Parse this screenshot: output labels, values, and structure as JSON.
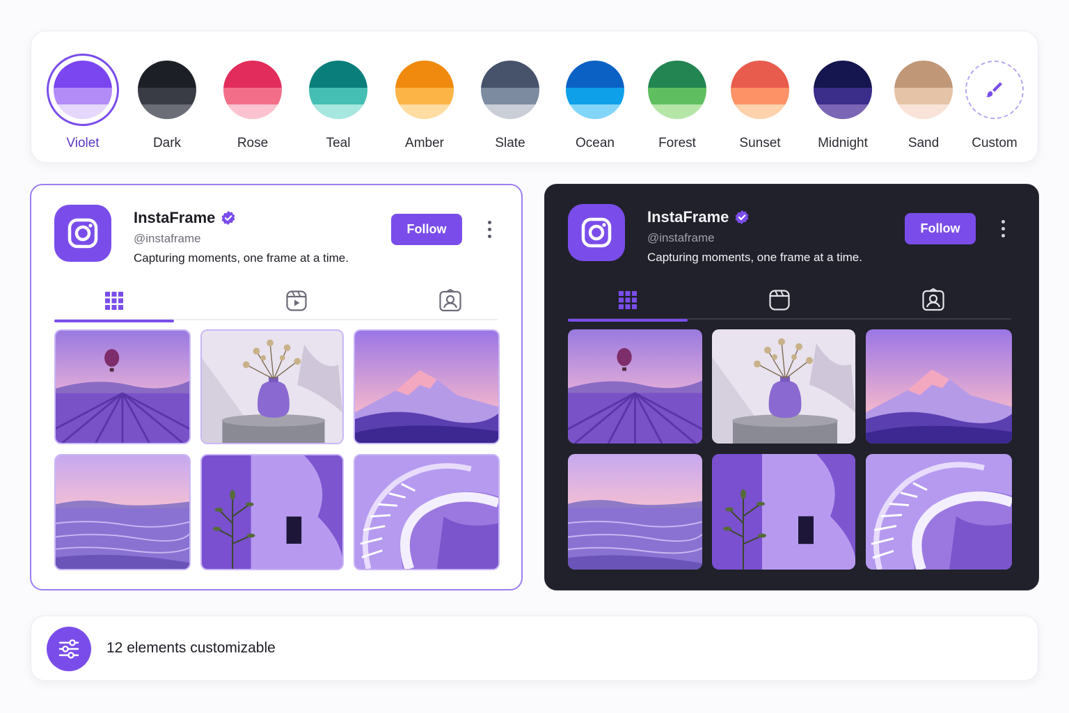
{
  "themes": [
    {
      "label": "Violet",
      "colors": [
        "#7b45f0",
        "#b48cf8",
        "#e6d8fd"
      ],
      "selected": true
    },
    {
      "label": "Dark",
      "colors": [
        "#1d1f26",
        "#3a3c45",
        "#6b6d77"
      ]
    },
    {
      "label": "Rose",
      "colors": [
        "#e12c5c",
        "#f36f89",
        "#fbc3cf"
      ]
    },
    {
      "label": "Teal",
      "colors": [
        "#0a7e7a",
        "#45bfb3",
        "#a6e7df"
      ]
    },
    {
      "label": "Amber",
      "colors": [
        "#ef8a0f",
        "#fdb446",
        "#fedca2"
      ]
    },
    {
      "label": "Slate",
      "colors": [
        "#46536a",
        "#7d8ba1",
        "#c9ced7"
      ]
    },
    {
      "label": "Ocean",
      "colors": [
        "#0b62c4",
        "#0fa0ea",
        "#83d5f8"
      ]
    },
    {
      "label": "Forest",
      "colors": [
        "#228552",
        "#5fbf60",
        "#b5e6a8"
      ]
    },
    {
      "label": "Sunset",
      "colors": [
        "#e85c4e",
        "#fd9266",
        "#fed2ad"
      ]
    },
    {
      "label": "Midnight",
      "colors": [
        "#15154f",
        "#3b2d8a",
        "#7a66b5"
      ]
    },
    {
      "label": "Sand",
      "colors": [
        "#c09878",
        "#e4c3a6",
        "#f9e3d8"
      ]
    },
    {
      "label": "Custom",
      "colors": []
    }
  ],
  "profile": {
    "name": "InstaFrame",
    "handle": "@instaframe",
    "bio": "Capturing moments, one frame at a time.",
    "follow_label": "Follow"
  },
  "bottom": {
    "text": "12 elements customizable"
  },
  "accent": "#7a4dea"
}
